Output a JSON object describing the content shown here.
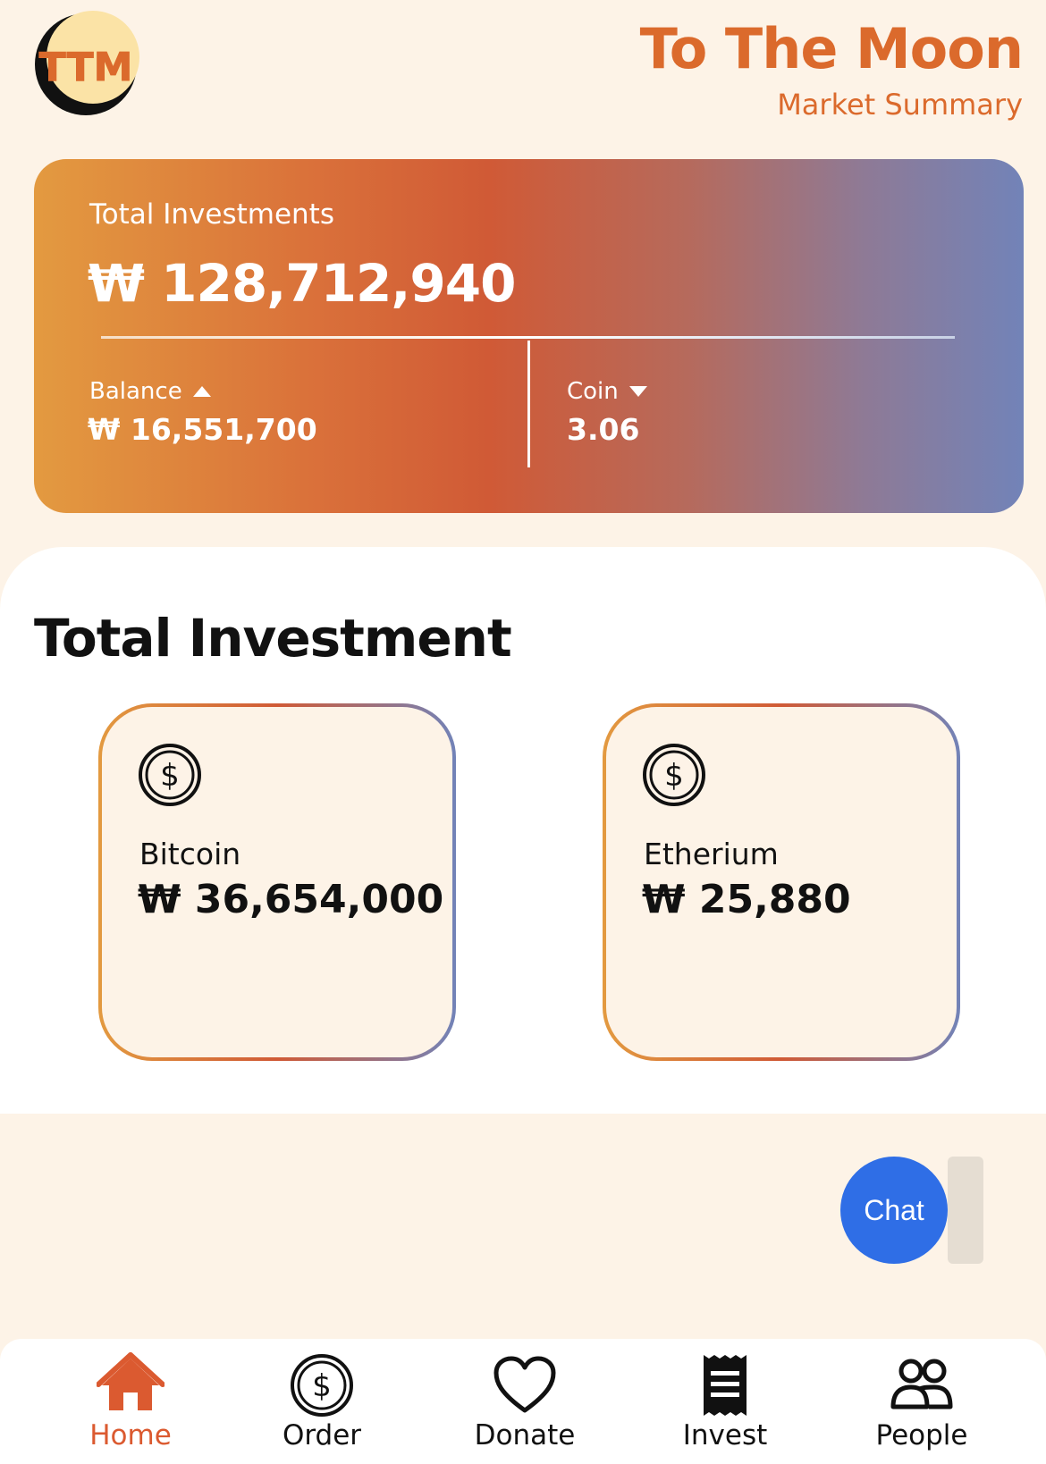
{
  "header": {
    "logo_text": "TTM",
    "title": "To The Moon",
    "subtitle": "Market Summary"
  },
  "summary": {
    "label": "Total Investments",
    "total": "₩ 128,712,940",
    "balance_label": "Balance",
    "balance_value": "₩ 16,551,700",
    "balance_trend": "up",
    "coin_label": "Coin",
    "coin_value": "3.06",
    "coin_trend": "down"
  },
  "investments": {
    "title": "Total Investment",
    "items": [
      {
        "name": "Bitcoin",
        "amount": "₩ 36,654,000",
        "icon": "dollar-coin-icon"
      },
      {
        "name": "Etherium",
        "amount": "₩ 25,880",
        "icon": "dollar-coin-icon"
      }
    ]
  },
  "chat": {
    "label": "Chat",
    "color": "#2f6ee6"
  },
  "nav": {
    "items": [
      {
        "label": "Home",
        "icon": "home-icon",
        "active": true
      },
      {
        "label": "Order",
        "icon": "dollar-coin-icon",
        "active": false
      },
      {
        "label": "Donate",
        "icon": "heart-icon",
        "active": false
      },
      {
        "label": "Invest",
        "icon": "receipt-icon",
        "active": false
      },
      {
        "label": "People",
        "icon": "people-icon",
        "active": false
      }
    ]
  },
  "colors": {
    "accent": "#db6a2c",
    "background": "#fdf3e7",
    "gradient_start": "#e39a40",
    "gradient_mid": "#d05a36",
    "gradient_end": "#7283b8"
  }
}
